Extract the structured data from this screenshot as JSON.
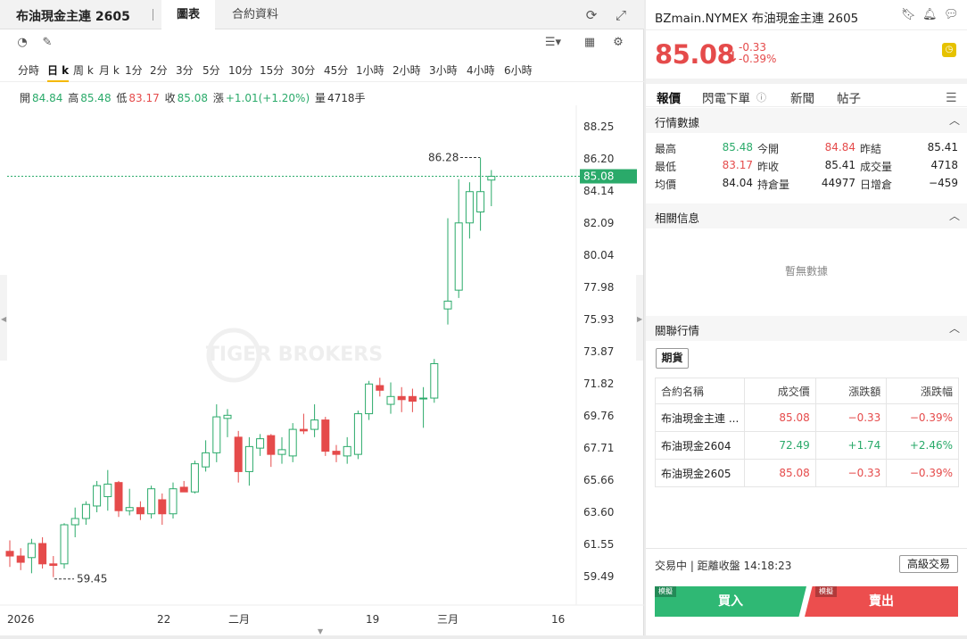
{
  "left": {
    "title": "布油現金主連 2605",
    "tabs": [
      "圖表",
      "合約資料"
    ],
    "periods": [
      "分時",
      "日 k",
      "周 k",
      "月 k",
      "1分",
      "2分",
      "3分",
      "5分",
      "10分",
      "15分",
      "30分",
      "45分",
      "1小時",
      "2小時",
      "3小時",
      "4小時",
      "6小時"
    ],
    "active_period": "日 k",
    "ohlc": {
      "open_label": "開",
      "open": "84.84",
      "high_label": "高",
      "high": "85.48",
      "low_label": "低",
      "low": "83.17",
      "close_label": "收",
      "close": "85.08",
      "change_label": "漲",
      "change": "+1.01(+1.20%)",
      "volume_label": "量",
      "volume": "4718手"
    },
    "watermark": "TIGER BROKERS"
  },
  "chart_data": {
    "type": "candlestick",
    "y_ticks": [
      "88.25",
      "86.20",
      "84.14",
      "82.09",
      "80.04",
      "77.98",
      "75.93",
      "73.87",
      "71.82",
      "69.76",
      "67.71",
      "65.66",
      "63.60",
      "61.55",
      "59.49"
    ],
    "ylim": [
      59.49,
      88.25
    ],
    "x_ticks": [
      "2026",
      "22",
      "二月",
      "19",
      "三月",
      "16"
    ],
    "current_price": "85.08",
    "max_label": "86.28",
    "min_label": "59.45",
    "candles": [
      {
        "o": 61.1,
        "h": 61.8,
        "l": 60.1,
        "c": 60.8
      },
      {
        "o": 60.8,
        "h": 61.3,
        "l": 59.9,
        "c": 60.4
      },
      {
        "o": 60.7,
        "h": 61.9,
        "l": 59.7,
        "c": 61.6
      },
      {
        "o": 61.6,
        "h": 62.0,
        "l": 60.0,
        "c": 60.3
      },
      {
        "o": 60.3,
        "h": 60.8,
        "l": 59.45,
        "c": 60.2
      },
      {
        "o": 60.3,
        "h": 62.9,
        "l": 60.0,
        "c": 62.8
      },
      {
        "o": 62.8,
        "h": 63.9,
        "l": 62.0,
        "c": 63.2
      },
      {
        "o": 63.2,
        "h": 64.3,
        "l": 62.8,
        "c": 64.1
      },
      {
        "o": 64.0,
        "h": 65.6,
        "l": 63.6,
        "c": 65.3
      },
      {
        "o": 64.6,
        "h": 66.3,
        "l": 63.7,
        "c": 65.4
      },
      {
        "o": 65.5,
        "h": 65.6,
        "l": 63.3,
        "c": 63.7
      },
      {
        "o": 63.7,
        "h": 65.1,
        "l": 63.4,
        "c": 63.9
      },
      {
        "o": 63.9,
        "h": 64.3,
        "l": 63.1,
        "c": 63.5
      },
      {
        "o": 63.5,
        "h": 65.3,
        "l": 63.2,
        "c": 65.1
      },
      {
        "o": 64.4,
        "h": 64.8,
        "l": 62.8,
        "c": 63.5
      },
      {
        "o": 63.5,
        "h": 65.5,
        "l": 63.2,
        "c": 65.1
      },
      {
        "o": 65.2,
        "h": 65.6,
        "l": 64.9,
        "c": 64.9
      },
      {
        "o": 64.9,
        "h": 66.9,
        "l": 64.8,
        "c": 66.7
      },
      {
        "o": 66.5,
        "h": 68.2,
        "l": 66.2,
        "c": 67.4
      },
      {
        "o": 67.4,
        "h": 70.5,
        "l": 66.8,
        "c": 69.7
      },
      {
        "o": 69.6,
        "h": 70.2,
        "l": 68.4,
        "c": 69.8
      },
      {
        "o": 68.4,
        "h": 68.8,
        "l": 65.5,
        "c": 66.2
      },
      {
        "o": 66.2,
        "h": 68.4,
        "l": 65.3,
        "c": 67.8
      },
      {
        "o": 67.7,
        "h": 68.6,
        "l": 67.2,
        "c": 68.3
      },
      {
        "o": 68.5,
        "h": 68.6,
        "l": 66.5,
        "c": 67.3
      },
      {
        "o": 67.3,
        "h": 68.4,
        "l": 66.7,
        "c": 67.6
      },
      {
        "o": 67.2,
        "h": 69.3,
        "l": 66.8,
        "c": 68.9
      },
      {
        "o": 68.9,
        "h": 69.9,
        "l": 68.6,
        "c": 68.8
      },
      {
        "o": 68.9,
        "h": 70.5,
        "l": 68.4,
        "c": 69.5
      },
      {
        "o": 69.5,
        "h": 69.7,
        "l": 67.2,
        "c": 67.5
      },
      {
        "o": 67.5,
        "h": 67.9,
        "l": 66.8,
        "c": 67.3
      },
      {
        "o": 67.2,
        "h": 68.4,
        "l": 66.7,
        "c": 67.8
      },
      {
        "o": 67.3,
        "h": 70.1,
        "l": 67.0,
        "c": 69.9
      },
      {
        "o": 69.9,
        "h": 72.0,
        "l": 69.5,
        "c": 71.8
      },
      {
        "o": 71.7,
        "h": 72.2,
        "l": 71.0,
        "c": 71.4
      },
      {
        "o": 70.5,
        "h": 71.9,
        "l": 69.9,
        "c": 71.0
      },
      {
        "o": 71.0,
        "h": 71.6,
        "l": 70.0,
        "c": 70.8
      },
      {
        "o": 71.0,
        "h": 71.5,
        "l": 70.0,
        "c": 70.7
      },
      {
        "o": 70.9,
        "h": 71.6,
        "l": 69.0,
        "c": 70.9
      },
      {
        "o": 70.9,
        "h": 73.4,
        "l": 70.6,
        "c": 73.1
      },
      {
        "o": 76.6,
        "h": 82.4,
        "l": 75.6,
        "c": 77.1
      },
      {
        "o": 77.8,
        "h": 84.9,
        "l": 77.3,
        "c": 82.1
      },
      {
        "o": 82.1,
        "h": 84.7,
        "l": 81.1,
        "c": 84.1
      },
      {
        "o": 82.8,
        "h": 86.28,
        "l": 81.6,
        "c": 84.1
      },
      {
        "o": 84.84,
        "h": 85.48,
        "l": 83.17,
        "c": 85.08
      }
    ],
    "colors": {
      "up": "#2aaa6a",
      "down": "#e54b4b"
    }
  },
  "right": {
    "symbol": "BZmain.NYMEX 布油現金主連 2605",
    "price": "85.08",
    "change": "-0.33",
    "change_pct": "-0.39%",
    "tabs": [
      "報價",
      "閃電下單",
      "新聞",
      "帖子"
    ],
    "quote_section": "行情數據",
    "stats": [
      [
        {
          "l": "最高",
          "v": "85.48",
          "c": "g"
        },
        {
          "l": "今開",
          "v": "84.84",
          "c": "r"
        },
        {
          "l": "昨結",
          "v": "85.41",
          "c": ""
        }
      ],
      [
        {
          "l": "最低",
          "v": "83.17",
          "c": "r"
        },
        {
          "l": "昨收",
          "v": "85.41",
          "c": ""
        },
        {
          "l": "成交量",
          "v": "4718",
          "c": ""
        }
      ],
      [
        {
          "l": "均價",
          "v": "84.04",
          "c": ""
        },
        {
          "l": "持倉量",
          "v": "44977",
          "c": ""
        },
        {
          "l": "日增倉",
          "v": "−459",
          "c": ""
        }
      ]
    ],
    "related_info_section": "相關信息",
    "empty_text": "暫無數據",
    "related_quotes_section": "關聯行情",
    "futures_btn": "期貨",
    "table_headers": [
      "合約名稱",
      "成交價",
      "漲跌額",
      "漲跌幅"
    ],
    "table_rows": [
      [
        {
          "v": "布油現金主連 ...",
          "c": ""
        },
        {
          "v": "85.08",
          "c": "r"
        },
        {
          "v": "−0.33",
          "c": "r"
        },
        {
          "v": "−0.39%",
          "c": "r"
        }
      ],
      [
        {
          "v": "布油現金2604",
          "c": ""
        },
        {
          "v": "72.49",
          "c": "g"
        },
        {
          "v": "+1.74",
          "c": "g"
        },
        {
          "v": "+2.46%",
          "c": "g"
        }
      ],
      [
        {
          "v": "布油現金2605",
          "c": ""
        },
        {
          "v": "85.08",
          "c": "r"
        },
        {
          "v": "−0.33",
          "c": "r"
        },
        {
          "v": "−0.39%",
          "c": "r"
        }
      ]
    ],
    "trade_status": "交易中 | 距離收盤 14:18:23",
    "advanced_btn": "高級交易",
    "buy": "買入",
    "sell": "賣出",
    "sim_tag": "模擬"
  }
}
